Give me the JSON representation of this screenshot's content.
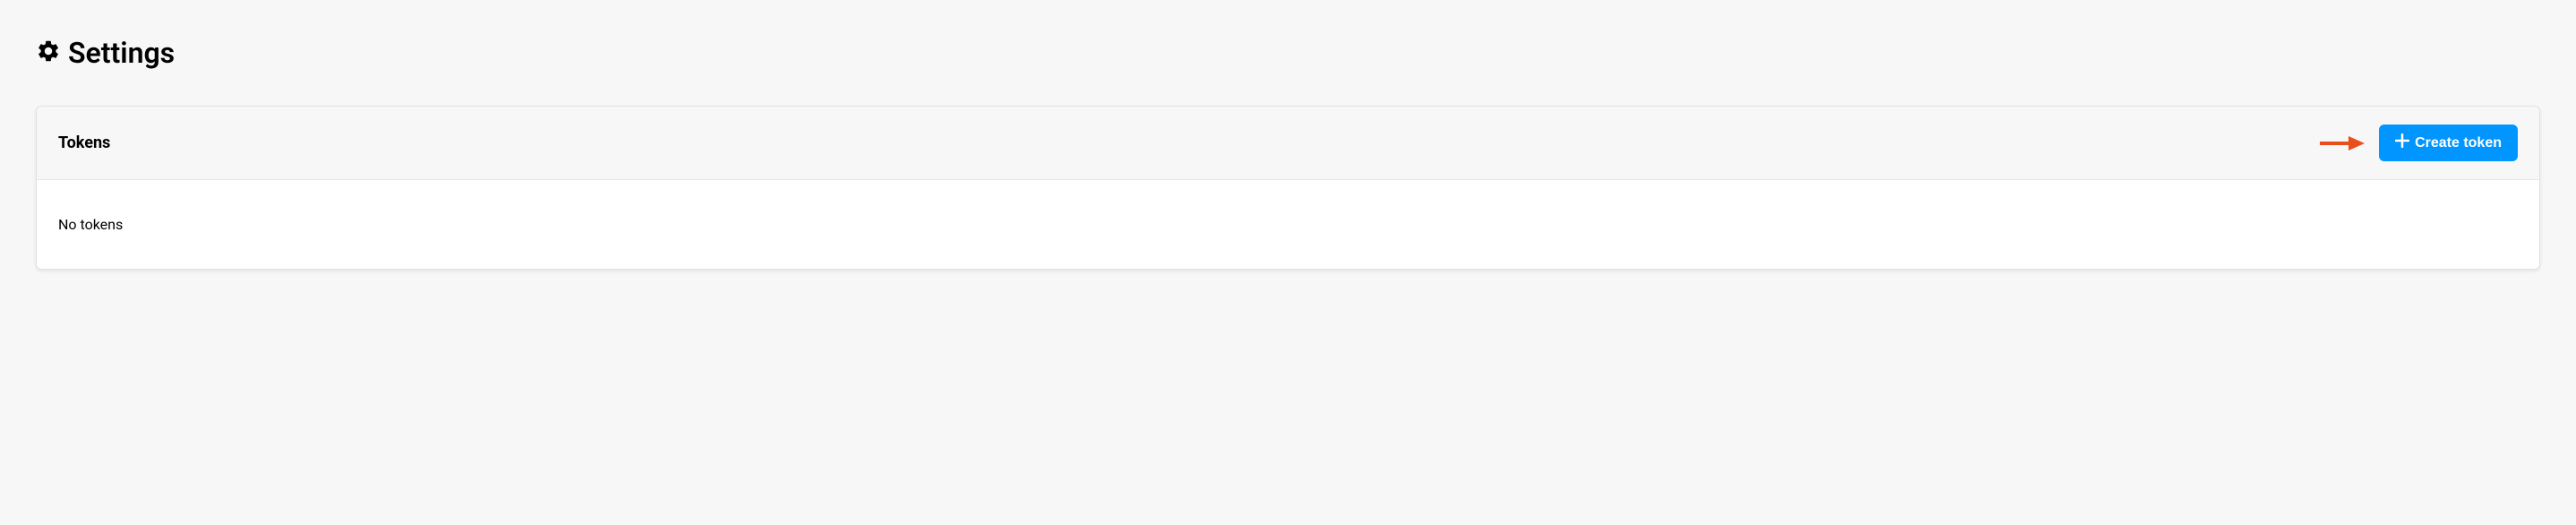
{
  "header": {
    "title": "Settings"
  },
  "card": {
    "title": "Tokens",
    "create_button_label": "Create token",
    "empty_message": "No tokens"
  }
}
